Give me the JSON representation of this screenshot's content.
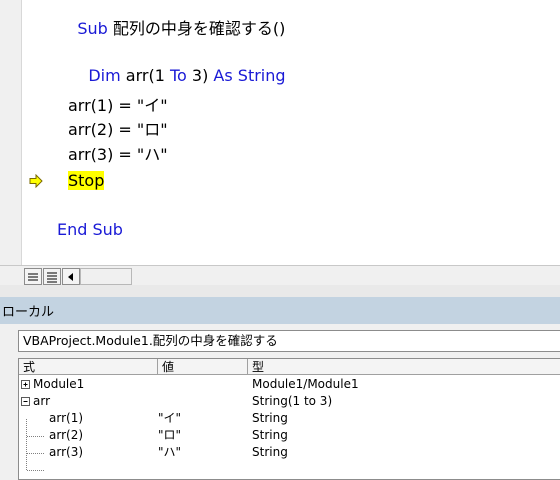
{
  "editor": {
    "lines": {
      "sub_kw": "Sub",
      "sub_name": " 配列の中身を確認する()",
      "dim_kw": "Dim",
      "dim_mid": " arr(1 ",
      "to_kw": "To",
      "dim_mid2": " 3) ",
      "as_kw": "As",
      "string_kw": " String",
      "assign1": "arr(1) = \"イ\"",
      "assign2": "arr(2) = \"ロ\"",
      "assign3": "arr(3) = \"ハ\"",
      "stop_kw": "Stop",
      "end_sub": "End Sub"
    },
    "execution_marker_icon": "yellow-arrow-icon",
    "highlight_color": "#ffff00",
    "keyword_color": "#1a1ad6"
  },
  "view_strip": {
    "procedure_view_icon": "procedure-view-icon",
    "module_view_icon": "full-module-view-icon",
    "scroll_left_icon": "scroll-left-icon"
  },
  "locals": {
    "title": "ローカル",
    "context": "VBAProject.Module1.配列の中身を確認する",
    "columns": [
      "式",
      "値",
      "型"
    ],
    "rows": [
      {
        "expr": "Module1",
        "value": "",
        "type": "Module1/Module1",
        "toggle": "+"
      },
      {
        "expr": "arr",
        "value": "",
        "type": "String(1 to 3)",
        "toggle": "-"
      },
      {
        "expr": "arr(1)",
        "value": "\"イ\"",
        "type": "String"
      },
      {
        "expr": "arr(2)",
        "value": "\"ロ\"",
        "type": "String"
      },
      {
        "expr": "arr(3)",
        "value": "\"ハ\"",
        "type": "String"
      }
    ]
  }
}
